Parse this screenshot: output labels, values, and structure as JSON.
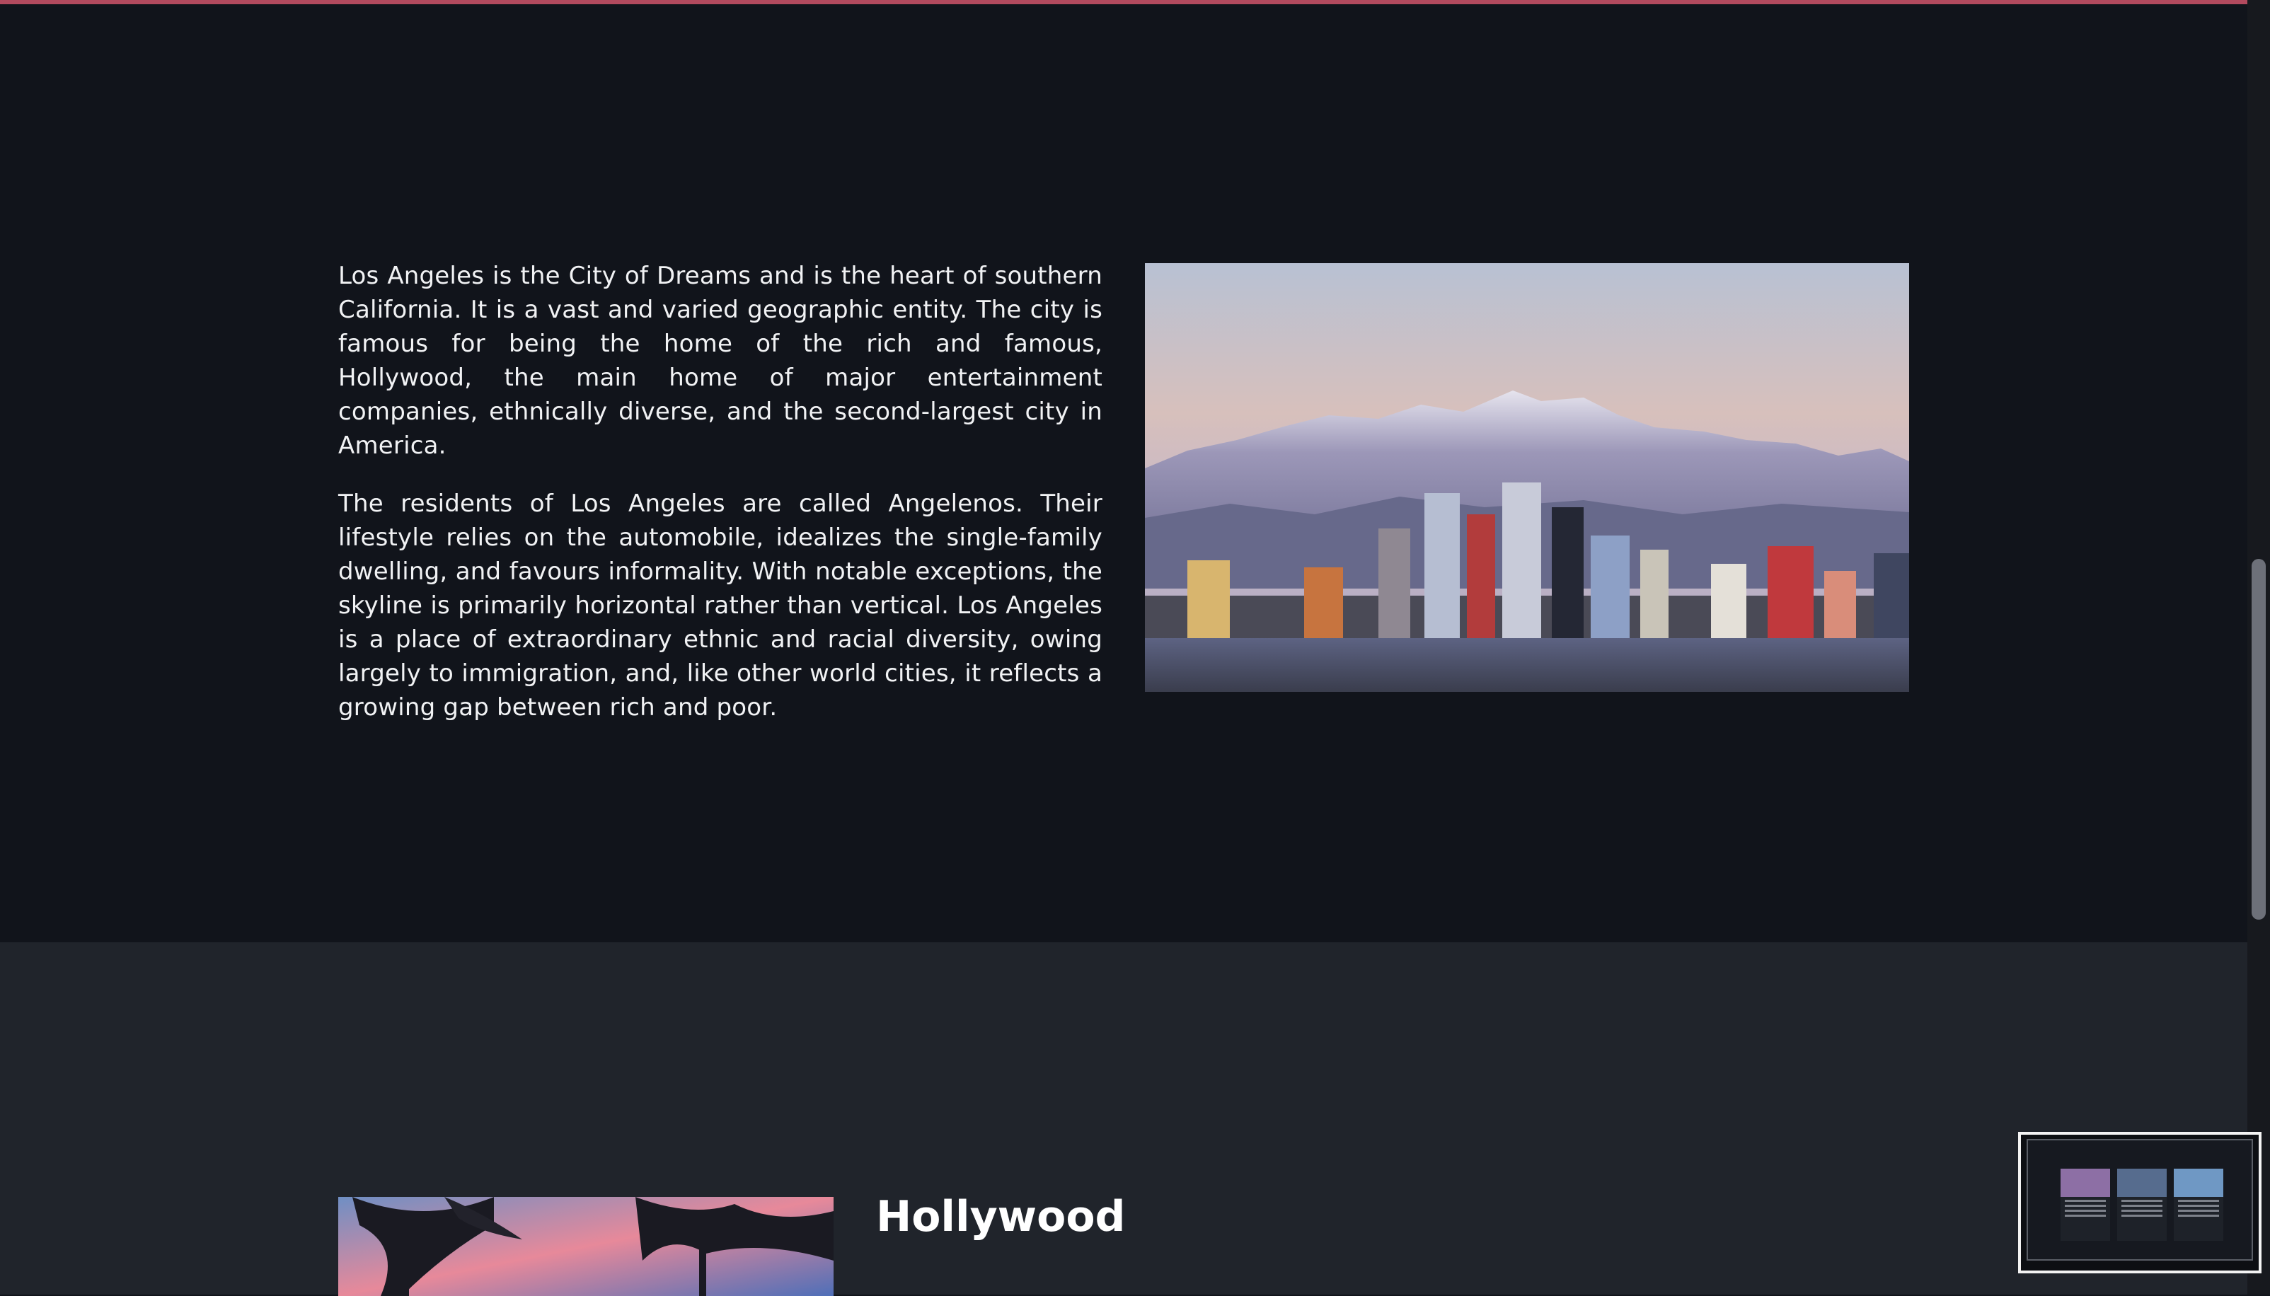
{
  "intro": {
    "paragraphs": [
      "Los Angeles is the City of Dreams and is the heart of southern California. It is a vast and varied geographic entity. The city is famous for being the home of the rich and famous, Hollywood, the main home of major entertainment companies, ethnically diverse, and the second-largest city in America.",
      "The residents of Los Angeles are called Angelenos. Their lifestyle relies on the automobile, idealizes the single-family dwelling, and favours informality. With notable exceptions, the skyline is primarily horizontal rather than vertical. Los Angeles is a place of extraordinary ethnic and racial diversity, owing largely to immigration, and, like other world cities, it reflects a growing gap between rich and poor."
    ]
  },
  "hollywood": {
    "title": "Hollywood"
  },
  "colors": {
    "page_background": "#11141b",
    "section_alt_background": "#20242b",
    "top_accent": "#b24a5e",
    "text": "#f1f2f4"
  },
  "minimap": {
    "cards": 3
  }
}
